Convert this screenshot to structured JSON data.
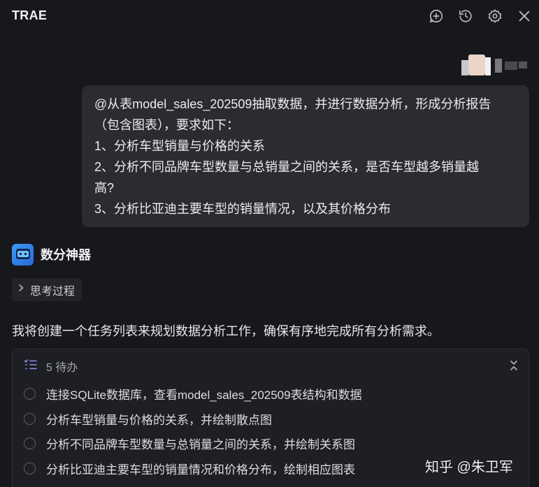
{
  "app": {
    "title": "TRAE"
  },
  "toolbar": {
    "icons": [
      "add-chat-icon",
      "history-icon",
      "settings-icon",
      "close-icon"
    ]
  },
  "user_message": {
    "lines": [
      "@从表model_sales_202509抽取数据，并进行数据分析，形成分析报告",
      "（包含图表），要求如下：",
      "1、分析车型销量与价格的关系",
      "2、分析不同品牌车型数量与总销量之间的关系，是否车型越多销量越",
      "高?",
      "3、分析比亚迪主要车型的销量情况，以及其价格分布"
    ]
  },
  "assistant": {
    "name": "数分神器",
    "thinking_label": "思考过程",
    "reply": "我将创建一个任务列表来规划数据分析工作，确保有序地完成所有分析需求。"
  },
  "todo": {
    "count_label": "5 待办",
    "items": [
      "连接SQLite数据库，查看model_sales_202509表结构和数据",
      "分析车型销量与价格的关系，并绘制散点图",
      "分析不同品牌车型数量与总销量之间的关系，并绘制关系图",
      "分析比亚迪主要车型的销量情况和价格分布，绘制相应图表"
    ]
  },
  "watermark": "知乎 @朱卫军",
  "colors": {
    "background": "#17181c",
    "bubble": "#2b2c31",
    "accent": "#3e9cf4"
  }
}
